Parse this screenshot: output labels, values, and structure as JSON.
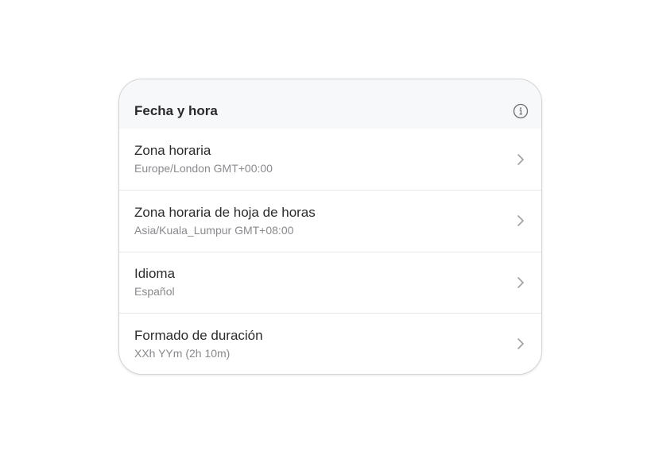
{
  "panel": {
    "title": "Fecha y hora",
    "info_icon": "info-circle-icon",
    "items": [
      {
        "label": "Zona horaria",
        "value": "Europe/London GMT+00:00"
      },
      {
        "label": "Zona horaria de hoja de horas",
        "value": "Asia/Kuala_Lumpur GMT+08:00"
      },
      {
        "label": "Idioma",
        "value": "Español"
      },
      {
        "label": "Formado de duración",
        "value": "XXh YYm (2h 10m)"
      }
    ]
  },
  "colors": {
    "header_bg": "#f7f8f9",
    "title_text": "#2a2a2c",
    "subtitle_text": "#8a8a8e",
    "divider": "#e6e6e8",
    "chevron": "#a0a0a4"
  }
}
